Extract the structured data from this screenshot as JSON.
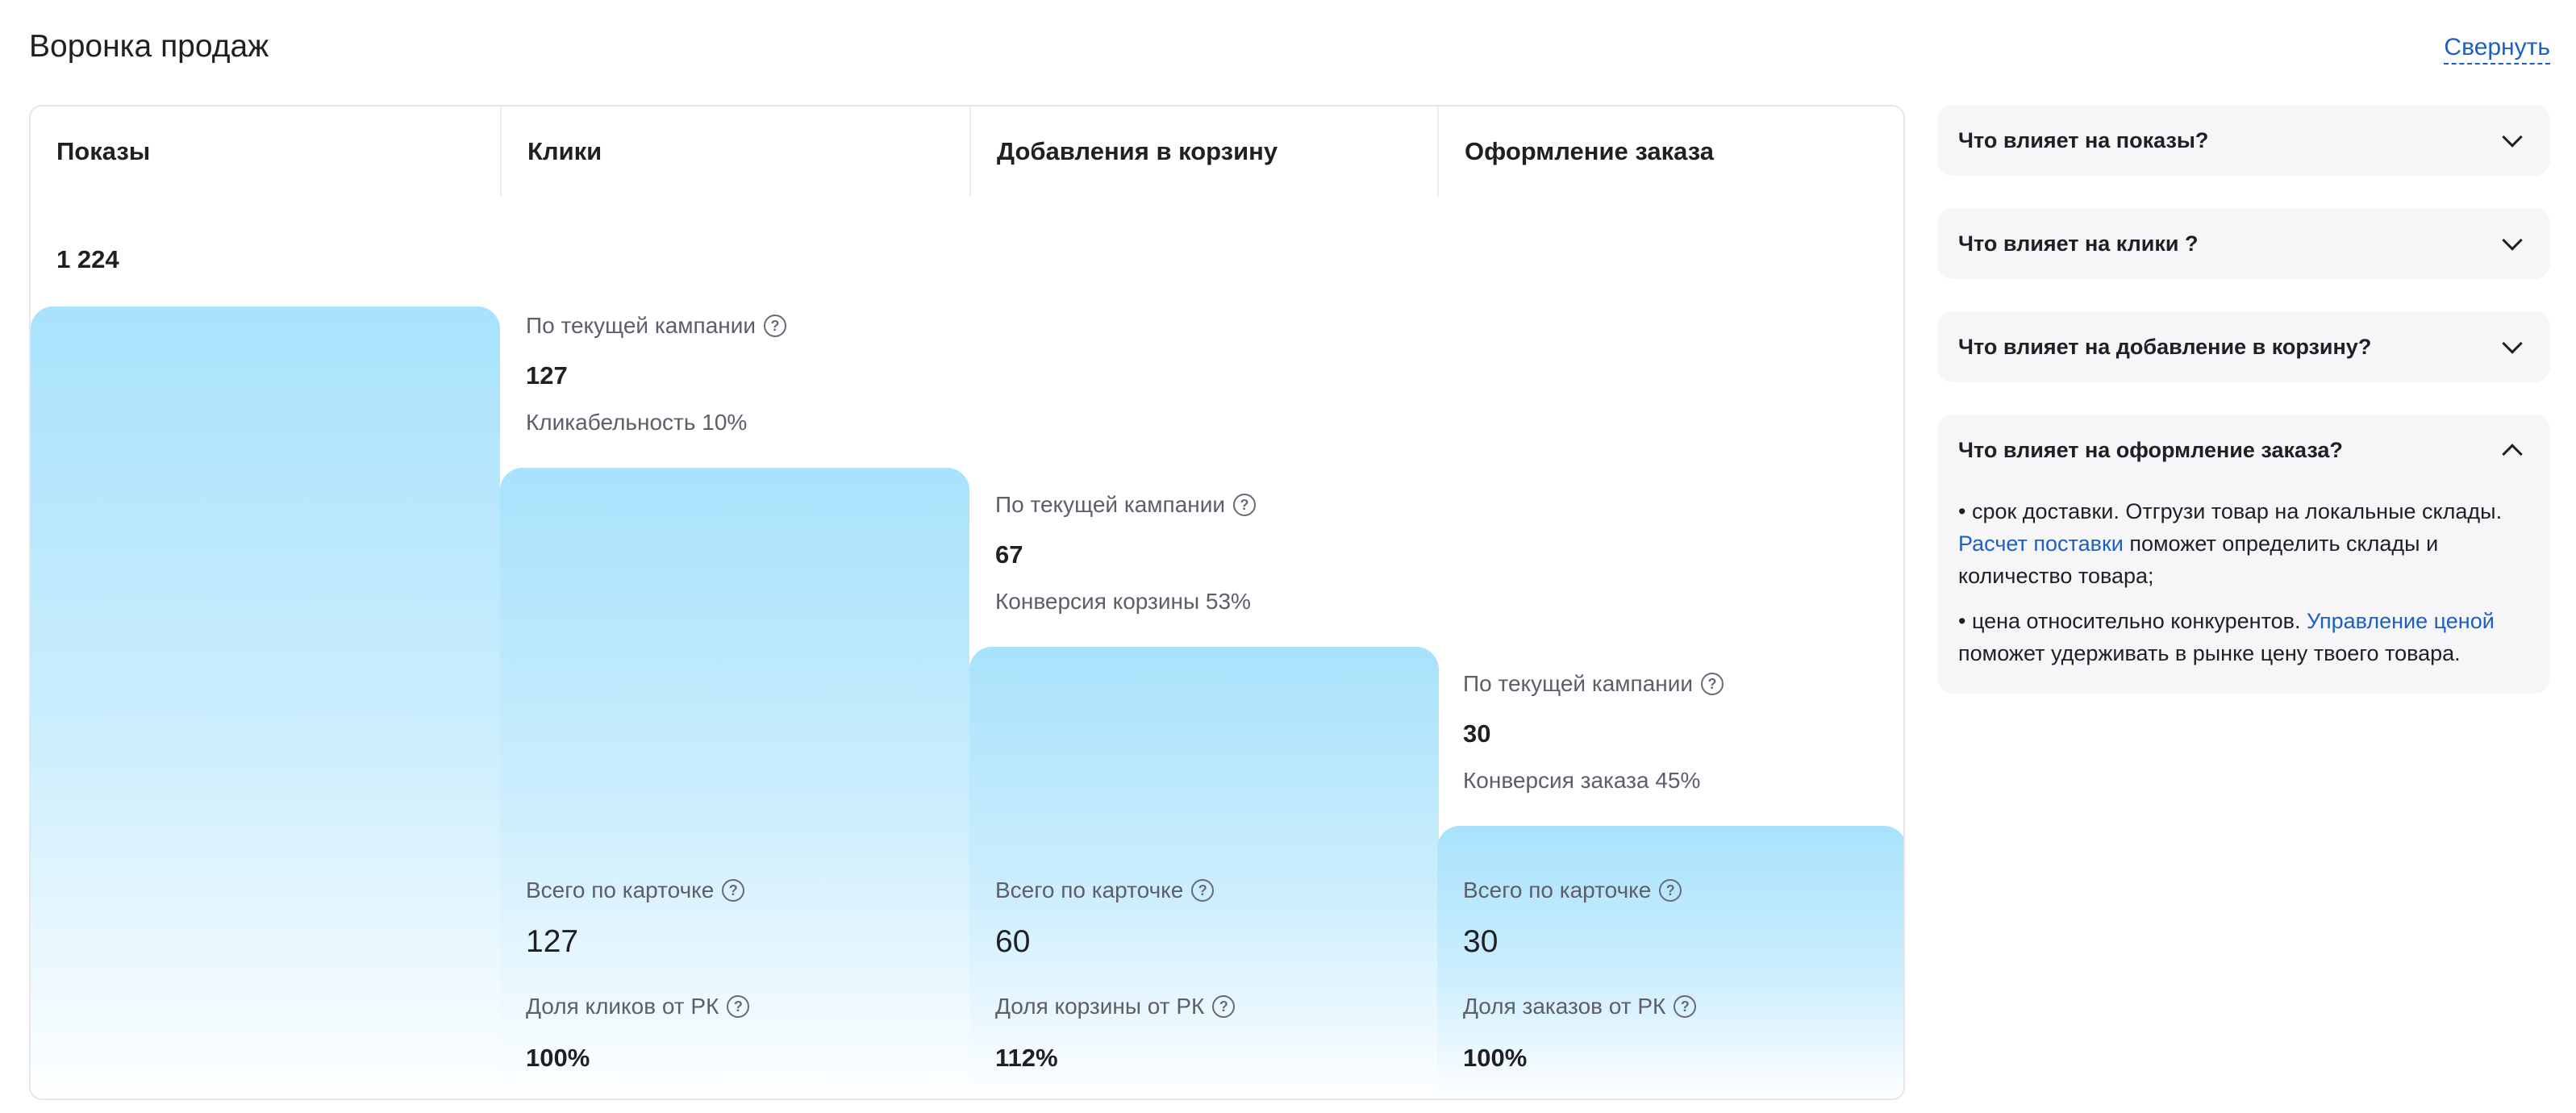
{
  "header": {
    "title": "Воронка продаж",
    "collapse_label": "Свернуть"
  },
  "funnel": {
    "columns": [
      {
        "title": "Показы"
      },
      {
        "title": "Клики"
      },
      {
        "title": "Добавления в корзину"
      },
      {
        "title": "Оформление заказа"
      }
    ],
    "impressions": {
      "value": "1 224"
    },
    "campaign": [
      {
        "label": "По текущей кампании",
        "value": "127",
        "rate": "Кликабельность 10%"
      },
      {
        "label": "По текущей кампании",
        "value": "67",
        "rate": "Конверсия корзины 53%"
      },
      {
        "label": "По текущей кампании",
        "value": "30",
        "rate": "Конверсия заказа 45%"
      }
    ],
    "card_totals": [
      {
        "label": "Всего по карточке",
        "value": "127",
        "share_label": "Доля кликов от РК",
        "share_value": "100%"
      },
      {
        "label": "Всего по карточке",
        "value": "60",
        "share_label": "Доля корзины от РК",
        "share_value": "112%"
      },
      {
        "label": "Всего по карточке",
        "value": "30",
        "share_label": "Доля заказов от РК",
        "share_value": "100%"
      }
    ],
    "bar_colors": {
      "top": "#a8e2fc",
      "bottom": "#ffffff"
    }
  },
  "faq": {
    "items": [
      {
        "question": "Что влияет на показы?"
      },
      {
        "question": "Что влияет на клики ?"
      },
      {
        "question": "Что влияет на добавление в корзину?"
      },
      {
        "question": "Что влияет на оформление заказа?",
        "p1_a": "• срок доставки. Отгрузи товар на локальные склады. ",
        "p1_link": "Расчет поставки",
        "p1_b": " поможет определить склады и количество товара;",
        "p2_a": "• цена относительно конкурентов. ",
        "p2_link": "Управление ценой",
        "p2_b": " поможет удерживать в рынке цену твоего товара."
      }
    ]
  },
  "colors": {
    "link": "#1d5fc2",
    "accent_bar": "#a8e2fc",
    "panel_bg": "#f6f6f9"
  }
}
